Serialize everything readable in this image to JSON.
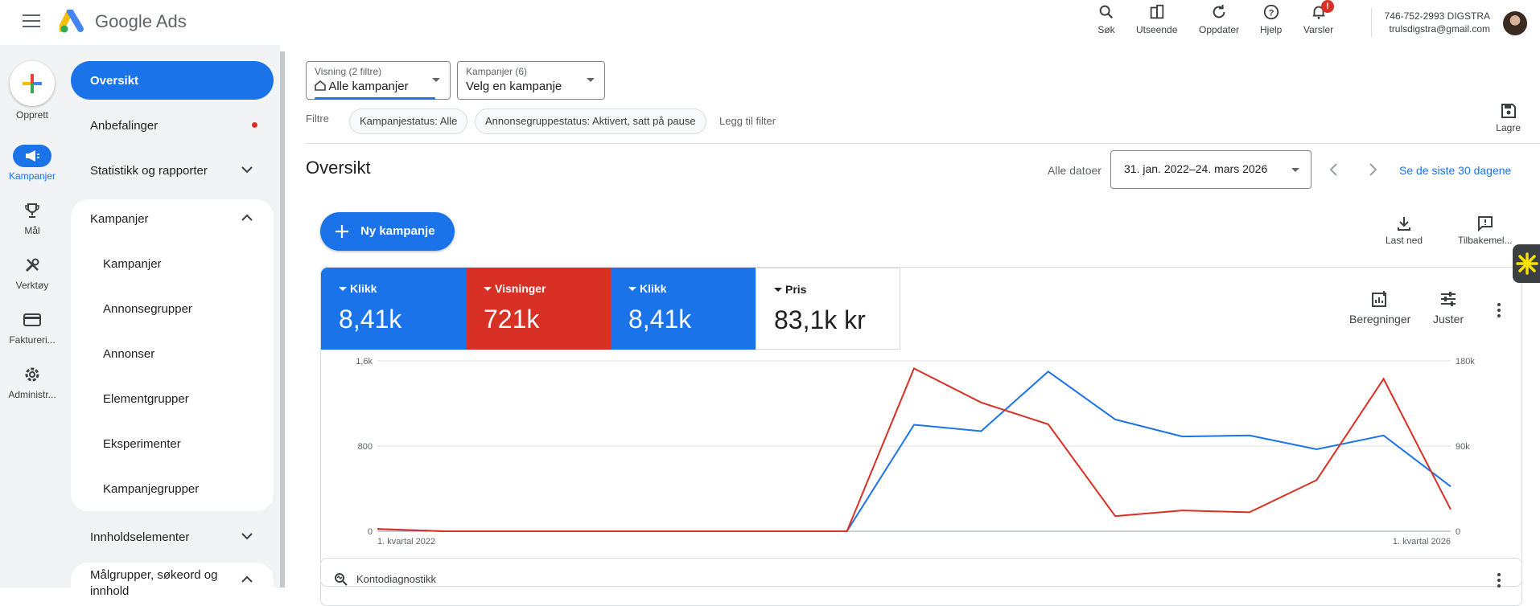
{
  "app": {
    "name": "Google Ads"
  },
  "toolbar": {
    "search": "Søk",
    "appearance": "Utseende",
    "refresh": "Oppdater",
    "help": "Hjelp",
    "alerts": "Varsler",
    "alerts_badge": "!"
  },
  "account": {
    "id_line": "746-752-2993 DIGSTRA",
    "email": "trulsdigstra@gmail.com"
  },
  "rail": {
    "create": "Opprett",
    "items": [
      {
        "label": "Kampanjer",
        "active": true
      },
      {
        "label": "Mål"
      },
      {
        "label": "Verktøy"
      },
      {
        "label": "Faktureri..."
      },
      {
        "label": "Administr..."
      }
    ]
  },
  "nav": {
    "overview": "Oversikt",
    "recommendations": "Anbefalinger",
    "stats": "Statistikk og rapporter",
    "campaigns_group": "Kampanjer",
    "sub": [
      "Kampanjer",
      "Annonsegrupper",
      "Annonser",
      "Elementgrupper",
      "Eksperimenter",
      "Kampanjegrupper"
    ],
    "assets": "Innholdselementer",
    "audiences": "Målgrupper, søkeord og innhold"
  },
  "selectors": {
    "view": {
      "label": "Visning (2 filtre)",
      "value": "Alle kampanjer"
    },
    "campaigns": {
      "label": "Kampanjer (6)",
      "value": "Velg en kampanje"
    }
  },
  "filters": {
    "label": "Filtre",
    "chips": [
      "Kampanjestatus: Alle",
      "Annonsegruppestatus: Aktivert, satt på pause"
    ],
    "add": "Legg til filter",
    "save": "Lagre"
  },
  "page": {
    "title": "Oversikt"
  },
  "dates": {
    "label": "Alle datoer",
    "range": "31. jan. 2022–24. mars 2026",
    "quick": "Se de siste 30 dagene"
  },
  "actions": {
    "new_campaign": "Ny kampanje",
    "download": "Last ned",
    "feedback": "Tilbakemel..."
  },
  "metrics": [
    {
      "label": "Klikk",
      "value": "8,41k",
      "color": "#1a73e8"
    },
    {
      "label": "Visninger",
      "value": "721k",
      "color": "#d93025"
    },
    {
      "label": "Klikk",
      "value": "8,41k",
      "color": "#1a73e8"
    },
    {
      "label": "Pris",
      "value": "83,1k kr",
      "color": "#ffffff"
    }
  ],
  "card_tools": {
    "calc": "Beregninger",
    "adjust": "Juster"
  },
  "chart_data": {
    "type": "line",
    "x": [
      0,
      1,
      2,
      3,
      4,
      5,
      6,
      7,
      8,
      9,
      10,
      11,
      12,
      13,
      14,
      15,
      16
    ],
    "x_tick_labels": [
      {
        "at": 0,
        "label": "1. kvartal 2022"
      },
      {
        "at": 16,
        "label": "1. kvartal 2026"
      }
    ],
    "y_left": {
      "ticks": [
        "0",
        "800",
        "1,6k"
      ],
      "range": [
        0,
        1600
      ]
    },
    "y_right": {
      "ticks": [
        "0",
        "90k",
        "180k"
      ],
      "range": [
        0,
        180000
      ]
    },
    "series": [
      {
        "axis": "left",
        "color": "#1a73e8",
        "values": [
          20,
          0,
          0,
          0,
          0,
          0,
          0,
          0,
          1000,
          940,
          1500,
          1050,
          890,
          900,
          770,
          900,
          420
        ]
      },
      {
        "axis": "right",
        "color": "#d93025",
        "values": [
          2500,
          0,
          0,
          0,
          0,
          0,
          0,
          0,
          172000,
          136000,
          113000,
          16000,
          22000,
          20000,
          54000,
          161000,
          23000
        ]
      }
    ],
    "grid": true
  },
  "diag": {
    "label": "Kontodiagnostikk"
  }
}
